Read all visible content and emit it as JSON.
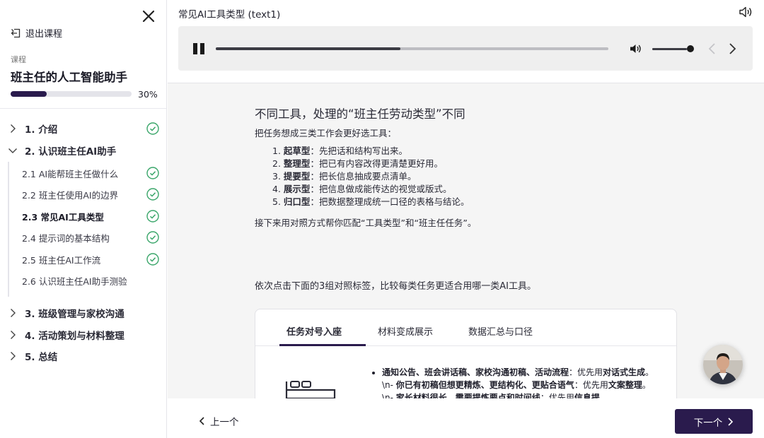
{
  "sidebar": {
    "exit_label": "退出课程",
    "course_label": "课程",
    "course_title": "班主任的人工智能助手",
    "progress_value": 0.3,
    "progress_text": "30%",
    "chapters": [
      {
        "label": "1. 介绍",
        "completed": true
      },
      {
        "label": "2. 认识班主任AI助手",
        "expanded": true
      },
      {
        "label": "3. 班级管理与家校沟通"
      },
      {
        "label": "4. 活动策划与材料整理"
      },
      {
        "label": "5. 总结"
      }
    ],
    "lessons": [
      {
        "label": "2.1 AI能帮班主任做什么",
        "completed": true
      },
      {
        "label": "2.2 班主任使用AI的边界",
        "completed": true
      },
      {
        "label": "2.3 常见AI工具类型",
        "completed": true,
        "active": true
      },
      {
        "label": "2.4 提示词的基本结构",
        "completed": true
      },
      {
        "label": "2.5 班主任AI工作流",
        "completed": true
      },
      {
        "label": "2.6 认识班主任AI助手测验",
        "completed": false
      }
    ]
  },
  "main": {
    "title": "常见AI工具类型 (text1)",
    "player": {
      "progress": 0.47,
      "volume": 0.9
    },
    "heading": "不同工具，处理的“班主任劳动类型”不同",
    "intro": "把任务想成三类工作会更好选工具：",
    "tool_types": [
      {
        "num": "1.",
        "name": "起草型",
        "desc": "：先把话和结构写出来。"
      },
      {
        "num": "2.",
        "name": "整理型",
        "desc": "：把已有内容改得更清楚更好用。"
      },
      {
        "num": "3.",
        "name": "提要型",
        "desc": "：把长信息抽成要点清单。"
      },
      {
        "num": "4.",
        "name": "展示型",
        "desc": "：把信息做成能传达的视觉或版式。"
      },
      {
        "num": "5.",
        "name": "归口型",
        "desc": "：把数据整理成统一口径的表格与结论。"
      }
    ],
    "after_list": "接下来用对照方式帮你匹配“工具类型”和“班主任任务”。",
    "instruction": "依次点击下面的3组对照标签，比较每类任务更适合用哪一类AI工具。",
    "tabs": [
      "任务对号入座",
      "材料变成展示",
      "数据汇总与口径"
    ],
    "card_parts": [
      {
        "t": "通知公告、班会讲话稿、家校沟通初稿、活动流程",
        "b": true
      },
      {
        "t": "：优先用",
        "b": false
      },
      {
        "t": "对话式生成",
        "b": true
      },
      {
        "t": "。\\n- ",
        "b": false
      },
      {
        "t": "你已有初稿但想更精炼、更结构化、更贴合语气",
        "b": true
      },
      {
        "t": "：优先用",
        "b": false
      },
      {
        "t": "文案整理",
        "b": true
      },
      {
        "t": "。\\n- ",
        "b": false
      },
      {
        "t": "家长材料很长，需要提炼要点和时间线",
        "b": true
      },
      {
        "t": "：优先用",
        "b": false
      },
      {
        "t": "信息提",
        "b": true
      }
    ]
  },
  "footer": {
    "prev_label": "上一个",
    "next_label": "下一个"
  },
  "colors": {
    "accent": "#2a1b4d",
    "check": "#3aa66a",
    "content_bg": "#f5f5f5",
    "player_bg": "#efefef"
  }
}
